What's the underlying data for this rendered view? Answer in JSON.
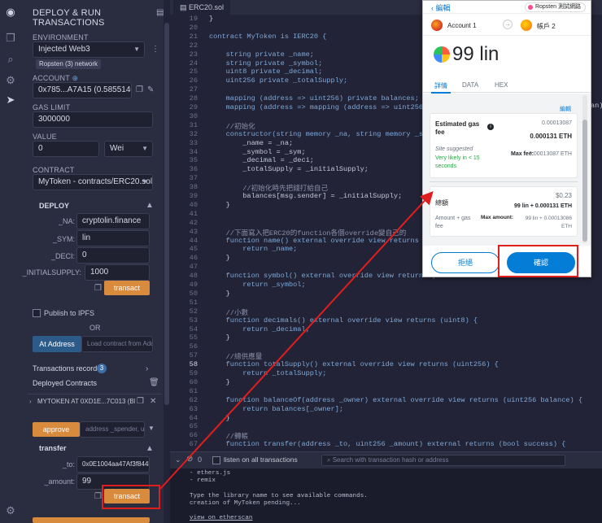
{
  "sidebar": {
    "title": "DEPLOY & RUN TRANSACTIONS",
    "environment": {
      "label": "ENVIRONMENT",
      "value": "Injected Web3",
      "network_badge": "Ropsten (3) network"
    },
    "account": {
      "label": "ACCOUNT",
      "value": "0x785...A7A15 (0.5855140"
    },
    "gas_limit": {
      "label": "GAS LIMIT",
      "value": "3000000"
    },
    "value": {
      "label": "VALUE",
      "amount": "0",
      "unit": "Wei"
    },
    "contract": {
      "label": "CONTRACT",
      "value": "MyToken - contracts/ERC20.sol"
    },
    "deploy": {
      "title": "DEPLOY",
      "params": [
        {
          "name": "_NA:",
          "value": "cryptolin.finance"
        },
        {
          "name": "_SYM:",
          "value": "lin"
        },
        {
          "name": "_DECI:",
          "value": "0"
        },
        {
          "name": "_INITIALSUPPLY:",
          "value": "1000"
        }
      ],
      "transact_label": "transact"
    },
    "publish_ipfs": "Publish to IPFS",
    "or_text": "OR",
    "at_address_label": "At Address",
    "load_contract_placeholder": "Load contract from Addre",
    "transactions_recorded": {
      "label": "Transactions recorded",
      "count": "3"
    },
    "deployed_contracts": "Deployed Contracts",
    "instance": {
      "title": "MYTOKEN AT 0XD1E...7C013 (BLC"
    },
    "approve": {
      "label": "approve",
      "placeholder": "address _spender, uint"
    },
    "transfer": {
      "title": "transfer",
      "to_label": "_to:",
      "to_value": "0x0E1004aa47Af3f844b",
      "amount_label": "_amount:",
      "amount_value": "99",
      "transact_label": "transact"
    }
  },
  "editor": {
    "tab": "ERC20.sol",
    "lines": [
      {
        "n": "19",
        "t": "}"
      },
      {
        "n": "20",
        "t": ""
      },
      {
        "n": "21",
        "t": "contract MyToken is IERC20 {"
      },
      {
        "n": "22",
        "t": ""
      },
      {
        "n": "23",
        "t": "    string private _name;"
      },
      {
        "n": "24",
        "t": "    string private _symbol;"
      },
      {
        "n": "25",
        "t": "    uint8 private _decimal;"
      },
      {
        "n": "26",
        "t": "    uint256 private _totalSupply;"
      },
      {
        "n": "27",
        "t": ""
      },
      {
        "n": "28",
        "t": "    mapping (address => uint256) private balances; //cryto..."
      },
      {
        "n": "29",
        "t": "    mapping (address => mapping (address => uint256)) priva"
      },
      {
        "n": "30",
        "t": ""
      },
      {
        "n": "31",
        "t": "    //初始化"
      },
      {
        "n": "32",
        "t": "    constructor(string memory _na, string memory _sym, uint"
      },
      {
        "n": "33",
        "t": "        _name = _na;"
      },
      {
        "n": "34",
        "t": "        _symbol = _sym;"
      },
      {
        "n": "35",
        "t": "        _decimal = _deci;"
      },
      {
        "n": "36",
        "t": "        _totalSupply = _initialSupply;"
      },
      {
        "n": "37",
        "t": ""
      },
      {
        "n": "38",
        "t": "        //初始化時先把錢打給自己"
      },
      {
        "n": "39",
        "t": "        balances[msg.sender] = _initialSupply;"
      },
      {
        "n": "40",
        "t": "    }"
      },
      {
        "n": "41",
        "t": ""
      },
      {
        "n": "42",
        "t": ""
      },
      {
        "n": "43",
        "t": "    //下面寫入把ERC20的function各個override變自己的"
      },
      {
        "n": "44",
        "t": "    function name() external override view returns (string"
      },
      {
        "n": "45",
        "t": "        return _name;"
      },
      {
        "n": "46",
        "t": "    }"
      },
      {
        "n": "47",
        "t": ""
      },
      {
        "n": "48",
        "t": "    function symbol() external override view returns (strin"
      },
      {
        "n": "49",
        "t": "        return _symbol;"
      },
      {
        "n": "50",
        "t": "    }"
      },
      {
        "n": "51",
        "t": ""
      },
      {
        "n": "52",
        "t": "    //小數"
      },
      {
        "n": "53",
        "t": "    function decimals() external override view returns (uint8) {"
      },
      {
        "n": "54",
        "t": "        return _decimal;"
      },
      {
        "n": "55",
        "t": "    }"
      },
      {
        "n": "56",
        "t": ""
      },
      {
        "n": "57",
        "t": "    //總供應量"
      },
      {
        "n": "58",
        "t": "    function totalSupply() external override view returns (uint256) {"
      },
      {
        "n": "59",
        "t": "        return _totalSupply;"
      },
      {
        "n": "60",
        "t": "    }"
      },
      {
        "n": "61",
        "t": ""
      },
      {
        "n": "62",
        "t": "    function balanceOf(address _owner) external override view returns (uint256 balance) {"
      },
      {
        "n": "63",
        "t": "        return balances[_owner];"
      },
      {
        "n": "64",
        "t": "    }"
      },
      {
        "n": "65",
        "t": ""
      },
      {
        "n": "66",
        "t": "    //轉帳"
      },
      {
        "n": "67",
        "t": "    function transfer(address _to, uint256 _amount) external returns (bool success) {"
      }
    ],
    "overflow_tail": "an)"
  },
  "terminal": {
    "count": "0",
    "listen_label": "listen on all transactions",
    "search_placeholder": "Search with transaction hash or address",
    "lines": [
      "- ethers.js",
      "- remix",
      "",
      "Type the library name to see available commands.",
      "creation of MyToken pending...",
      "",
      "view on etherscan"
    ]
  },
  "metamask": {
    "edit": "編輯",
    "network": "Ropsten 測試網路",
    "from_account": "Account 1",
    "to_account": "帳戶 2",
    "amount": "99 lin",
    "tabs": [
      "詳情",
      "DATA",
      "HEX"
    ],
    "edit_link": "編輯",
    "gas_title": "Estimated gas fee",
    "gas_eth_small": "0.00013087",
    "gas_eth_bold": "0.000131 ETH",
    "site_suggested": "Site suggested",
    "likely": "Very likely in < 15 seconds",
    "max_fee_label": "Max fee:",
    "max_fee_value": "0.00013087 ETH",
    "total_label": "總額",
    "total_usd": "$0.23",
    "total_value": "99 lin + 0.000131 ETH",
    "amount_gas_label": "Amount + gas fee",
    "max_amount_label": "Max amount:",
    "max_amount_value": "99 lin + 0.00013086 ETH",
    "reject": "拒絕",
    "confirm": "確認"
  },
  "colors": {
    "accent_orange": "#d88a3d",
    "metamask_blue": "#037dd6",
    "annotation_red": "#e01e1e"
  }
}
